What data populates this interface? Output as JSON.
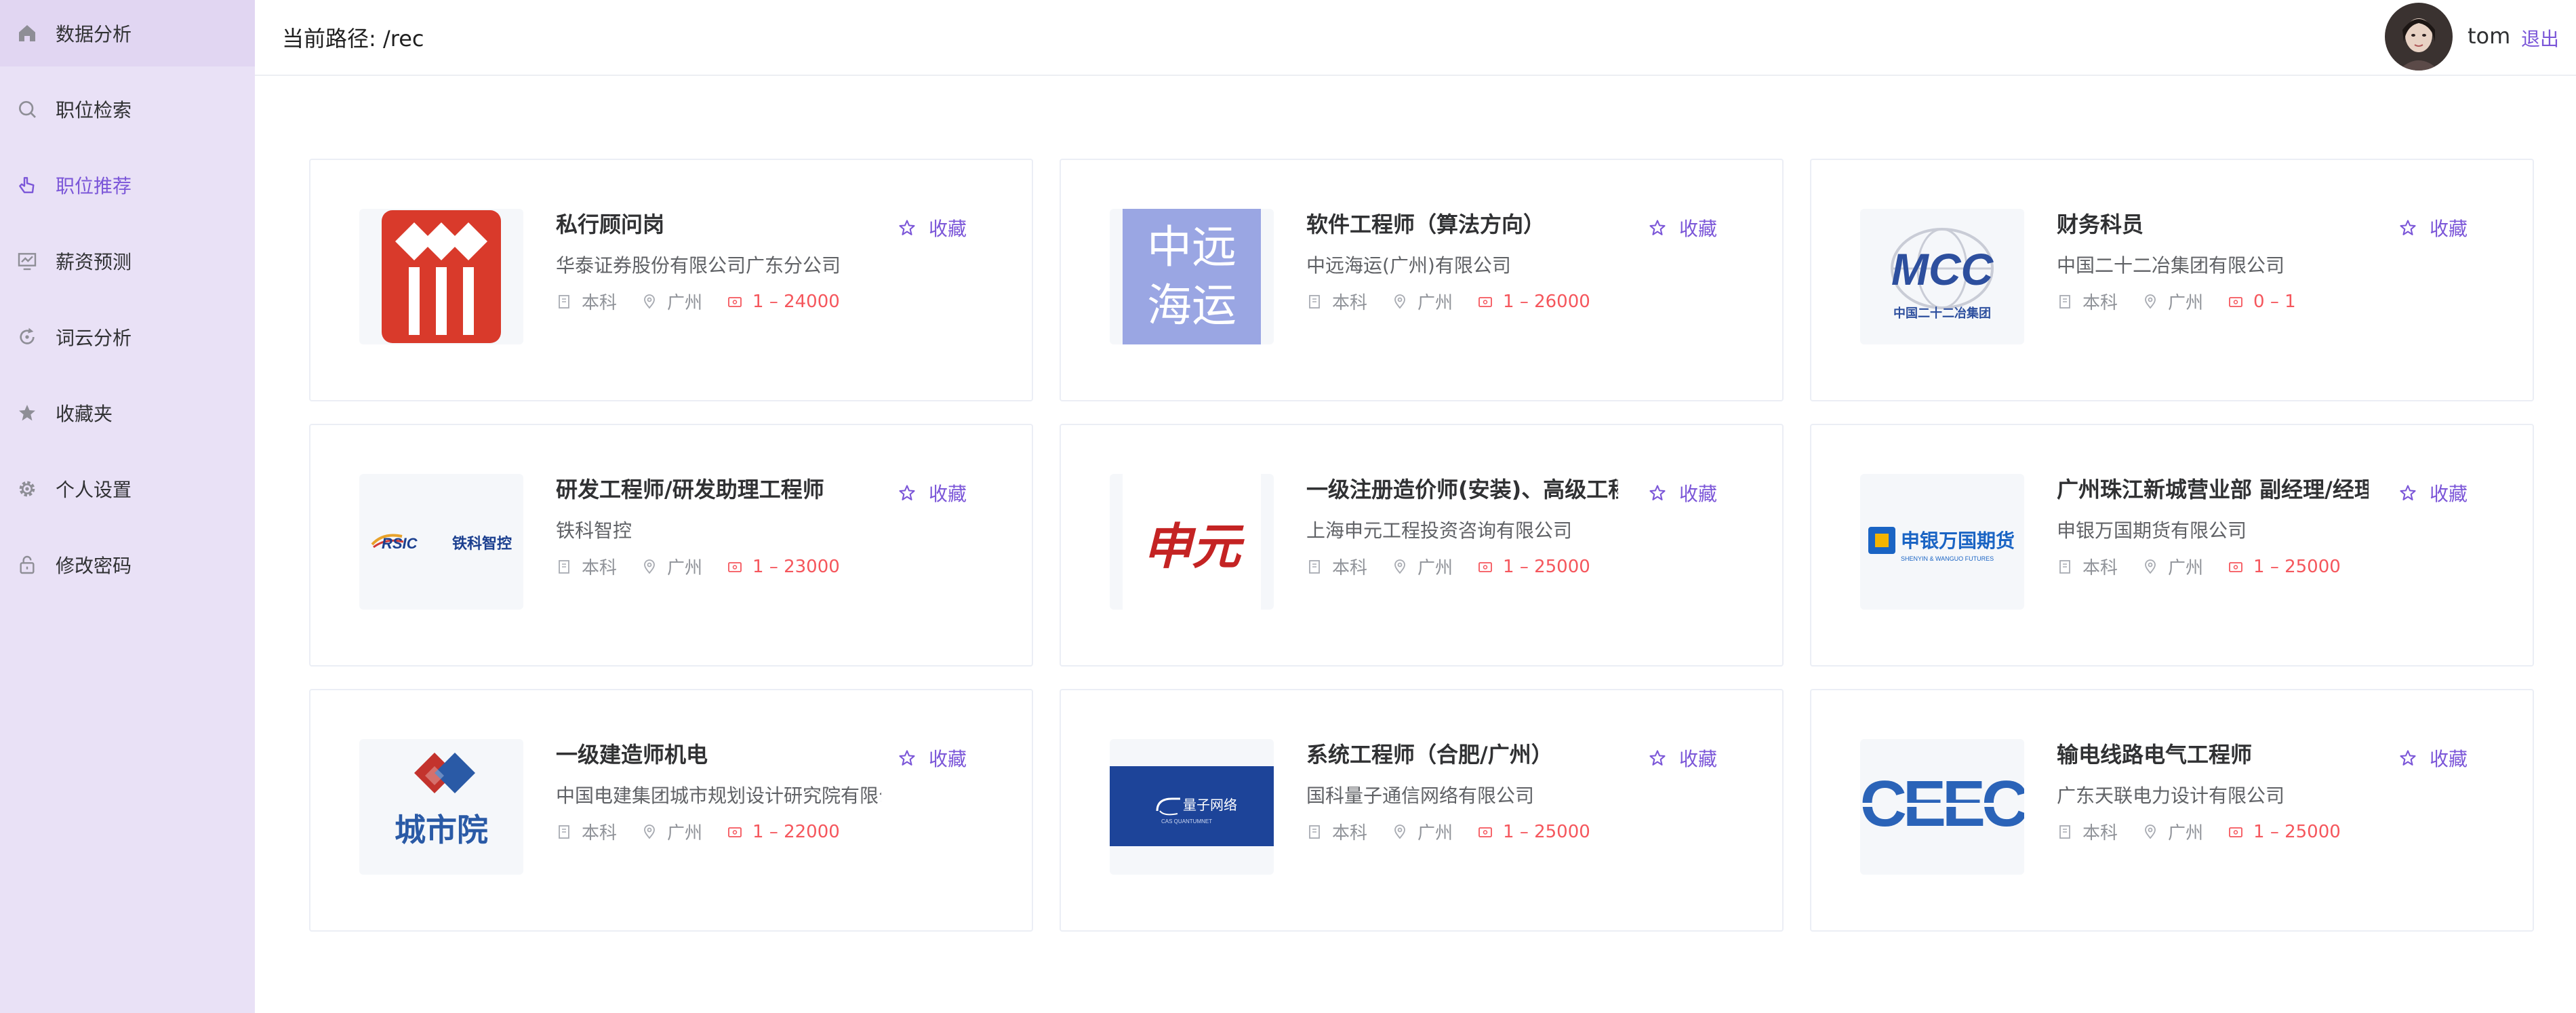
{
  "sidebar": {
    "items": [
      {
        "label": "数据分析",
        "icon": "home-icon"
      },
      {
        "label": "职位检索",
        "icon": "search-icon"
      },
      {
        "label": "职位推荐",
        "icon": "pointer-icon"
      },
      {
        "label": "薪资预测",
        "icon": "chart-icon"
      },
      {
        "label": "词云分析",
        "icon": "refresh-icon"
      },
      {
        "label": "收藏夹",
        "icon": "star-icon"
      },
      {
        "label": "个人设置",
        "icon": "gear-icon"
      },
      {
        "label": "修改密码",
        "icon": "lock-icon"
      }
    ]
  },
  "header": {
    "path": "当前路径: /rec",
    "username": "tom",
    "logout": "退出"
  },
  "colors": {
    "accent": "#7b56d8",
    "salary": "#f5565c",
    "sidebar_bg": "#e9e1f6"
  },
  "fav_label": "收藏",
  "jobs": [
    {
      "title": "私行顾问岗",
      "company": "华泰证券股份有限公司广东分公司",
      "edu": "本科",
      "city": "广州",
      "salary": "1 – 24000"
    },
    {
      "title": "软件工程师（算法方向）",
      "company": "中远海运(广州)有限公司",
      "edu": "本科",
      "city": "广州",
      "salary": "1 – 26000",
      "logo_text": [
        "中远",
        "海运"
      ]
    },
    {
      "title": "财务科员",
      "company": "中国二十二冶集团有限公司",
      "edu": "本科",
      "city": "广州",
      "salary": "0 – 1",
      "logo_text": [
        "MCC",
        "中国二十二冶集团"
      ]
    },
    {
      "title": "研发工程师/研发助理工程师",
      "company": "铁科智控",
      "edu": "本科",
      "city": "广州",
      "salary": "1 – 23000",
      "logo_text": [
        "RSIC",
        "铁科智控"
      ]
    },
    {
      "title": "一级注册造价师(安装)、高级工程师",
      "company": "上海申元工程投资咨询有限公司",
      "edu": "本科",
      "city": "广州",
      "salary": "1 – 25000",
      "logo_text": [
        "申元"
      ]
    },
    {
      "title": "广州珠江新城营业部 副经理/经理助理",
      "company": "申银万国期货有限公司",
      "edu": "本科",
      "city": "广州",
      "salary": "1 – 25000",
      "logo_text": [
        "申银万国期货",
        "SHENYIN & WANGUO FUTURES"
      ]
    },
    {
      "title": "一级建造师机电",
      "company": "中国电建集团城市规划设计研究院有限公司",
      "edu": "本科",
      "city": "广州",
      "salary": "1 – 22000",
      "logo_text": [
        "城市院"
      ]
    },
    {
      "title": "系统工程师（合肥/广州）",
      "company": "国科量子通信网络有限公司",
      "edu": "本科",
      "city": "广州",
      "salary": "1 – 25000",
      "logo_text": [
        "量子网络",
        "CAS QUANTUMNET"
      ]
    },
    {
      "title": "输电线路电气工程师",
      "company": "广东天联电力设计有限公司",
      "edu": "本科",
      "city": "广州",
      "salary": "1 – 25000",
      "logo_text": [
        "CEEC"
      ]
    }
  ]
}
